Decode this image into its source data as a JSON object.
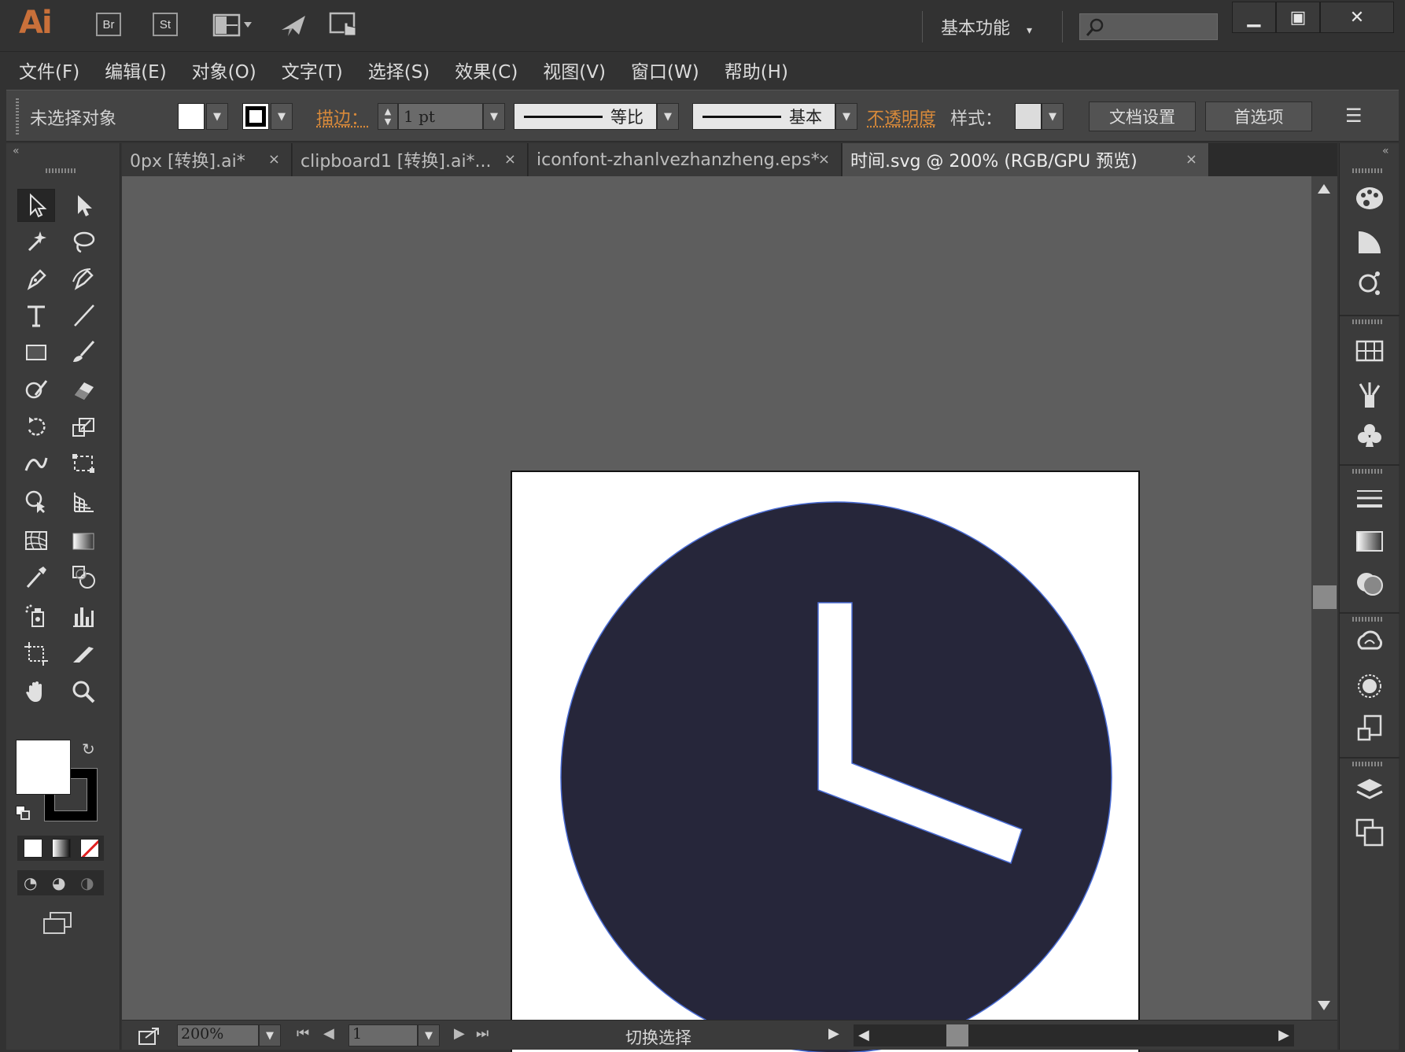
{
  "app": {
    "logo": "Ai",
    "bridge": "Br",
    "stock": "St",
    "workspace": "基本功能",
    "workspace_arrow": "▾",
    "minimize": "▁",
    "maximize": "▣",
    "close": "✕"
  },
  "menu": {
    "items": [
      "文件(F)",
      "编辑(E)",
      "对象(O)",
      "文字(T)",
      "选择(S)",
      "效果(C)",
      "视图(V)",
      "窗口(W)",
      "帮助(H)"
    ]
  },
  "controlbar": {
    "selection": "未选择对象",
    "stroke_label": "描边：",
    "stroke_value": "1 pt",
    "profile_label": "等比",
    "brush_label": "基本",
    "opacity_label": "不透明度",
    "style_label": "样式：",
    "doc_setup": "文档设置",
    "preferences": "首选项",
    "panel_menu": "☰"
  },
  "tabs": [
    {
      "label": "0px  [转换].ai*",
      "close": "×",
      "active": false
    },
    {
      "label": "clipboard1  [转换].ai*...",
      "close": "×",
      "active": false
    },
    {
      "label": "iconfont-zhanlvezhanzheng.eps*",
      "close": "×",
      "active": false
    },
    {
      "label": "时间.svg  @  200% (RGB/GPU 预览)",
      "close": "×",
      "active": true
    }
  ],
  "tab_overflow": ">>",
  "artwork": {
    "description_colors": {
      "clock_face": "#26263a",
      "hands": "#ffffff",
      "path_outline": "#4a6cd4"
    }
  },
  "status": {
    "zoom": "200%",
    "page": "1",
    "text": "切换选择"
  },
  "colors": {
    "accent": "#d98a3a",
    "fill": "#ffffff",
    "stroke": "#000000",
    "none_red": "#e02020"
  }
}
